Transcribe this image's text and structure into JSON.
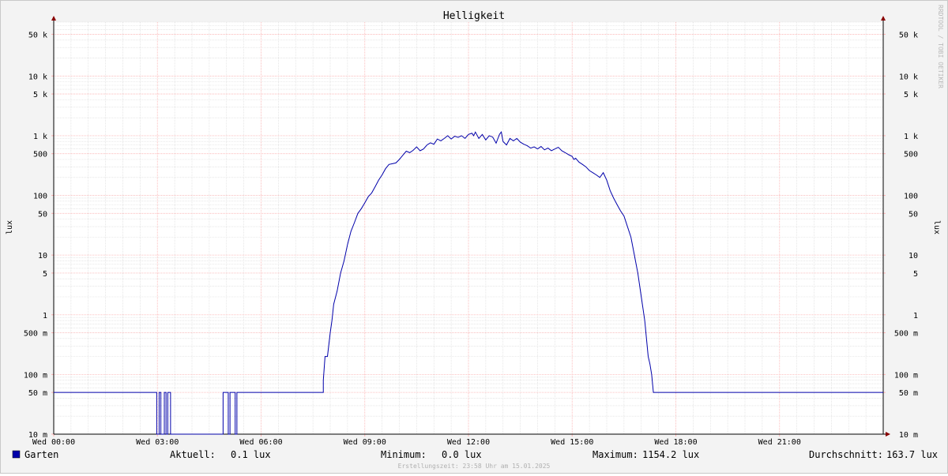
{
  "chart_data": {
    "type": "line",
    "title": "Helligkeit",
    "ylabel": "lux",
    "y_scale": "log",
    "ylim": [
      0.01,
      80000
    ],
    "x_range_hours": [
      0,
      24
    ],
    "x_ticks": [
      {
        "h": 0,
        "label": "Wed 00:00"
      },
      {
        "h": 3,
        "label": "Wed 03:00"
      },
      {
        "h": 6,
        "label": "Wed 06:00"
      },
      {
        "h": 9,
        "label": "Wed 09:00"
      },
      {
        "h": 12,
        "label": "Wed 12:00"
      },
      {
        "h": 15,
        "label": "Wed 15:00"
      },
      {
        "h": 18,
        "label": "Wed 18:00"
      },
      {
        "h": 21,
        "label": "Wed 21:00"
      }
    ],
    "y_ticks": [
      {
        "v": 0.01,
        "label": "10 m"
      },
      {
        "v": 0.05,
        "label": "50 m"
      },
      {
        "v": 0.1,
        "label": "100 m"
      },
      {
        "v": 0.5,
        "label": "500 m"
      },
      {
        "v": 1,
        "label": "1"
      },
      {
        "v": 5,
        "label": "5"
      },
      {
        "v": 10,
        "label": "10"
      },
      {
        "v": 50,
        "label": "50"
      },
      {
        "v": 100,
        "label": "100"
      },
      {
        "v": 500,
        "label": "500"
      },
      {
        "v": 1000,
        "label": "1 k"
      },
      {
        "v": 5000,
        "label": "5 k"
      },
      {
        "v": 10000,
        "label": "10 k"
      },
      {
        "v": 50000,
        "label": "50 k"
      }
    ],
    "series": [
      {
        "name": "Garten",
        "color": "#0000aa",
        "points": [
          [
            0,
            0.05
          ],
          [
            2.98,
            0.05
          ],
          [
            2.98,
            0.01
          ],
          [
            3.05,
            0.01
          ],
          [
            3.05,
            0.05
          ],
          [
            3.1,
            0.05
          ],
          [
            3.1,
            0.01
          ],
          [
            3.2,
            0.01
          ],
          [
            3.2,
            0.05
          ],
          [
            3.25,
            0.05
          ],
          [
            3.25,
            0.01
          ],
          [
            3.3,
            0.01
          ],
          [
            3.3,
            0.05
          ],
          [
            3.38,
            0.05
          ],
          [
            3.38,
            0.01
          ],
          [
            4.9,
            0.01
          ],
          [
            4.9,
            0.05
          ],
          [
            5.05,
            0.05
          ],
          [
            5.05,
            0.01
          ],
          [
            5.1,
            0.01
          ],
          [
            5.1,
            0.05
          ],
          [
            5.25,
            0.05
          ],
          [
            5.25,
            0.01
          ],
          [
            5.3,
            0.01
          ],
          [
            5.3,
            0.05
          ],
          [
            7.8,
            0.05
          ],
          [
            7.8,
            0.08
          ],
          [
            7.85,
            0.2
          ],
          [
            7.92,
            0.2
          ],
          [
            8.0,
            0.5
          ],
          [
            8.05,
            0.8
          ],
          [
            8.1,
            1.5
          ],
          [
            8.2,
            2.5
          ],
          [
            8.3,
            5
          ],
          [
            8.4,
            8
          ],
          [
            8.5,
            15
          ],
          [
            8.6,
            25
          ],
          [
            8.7,
            35
          ],
          [
            8.8,
            50
          ],
          [
            8.9,
            60
          ],
          [
            9.0,
            75
          ],
          [
            9.1,
            95
          ],
          [
            9.2,
            110
          ],
          [
            9.3,
            140
          ],
          [
            9.4,
            180
          ],
          [
            9.5,
            220
          ],
          [
            9.6,
            280
          ],
          [
            9.7,
            330
          ],
          [
            9.8,
            340
          ],
          [
            9.9,
            350
          ],
          [
            10.0,
            400
          ],
          [
            10.1,
            470
          ],
          [
            10.2,
            550
          ],
          [
            10.3,
            520
          ],
          [
            10.4,
            570
          ],
          [
            10.5,
            650
          ],
          [
            10.6,
            560
          ],
          [
            10.7,
            600
          ],
          [
            10.8,
            700
          ],
          [
            10.9,
            760
          ],
          [
            11.0,
            720
          ],
          [
            11.1,
            880
          ],
          [
            11.2,
            820
          ],
          [
            11.3,
            900
          ],
          [
            11.4,
            1000
          ],
          [
            11.5,
            880
          ],
          [
            11.6,
            980
          ],
          [
            11.7,
            940
          ],
          [
            11.8,
            1000
          ],
          [
            11.9,
            900
          ],
          [
            12.0,
            1050
          ],
          [
            12.1,
            1100
          ],
          [
            12.15,
            1000
          ],
          [
            12.2,
            1150
          ],
          [
            12.3,
            900
          ],
          [
            12.4,
            1050
          ],
          [
            12.5,
            850
          ],
          [
            12.6,
            1000
          ],
          [
            12.7,
            950
          ],
          [
            12.8,
            750
          ],
          [
            12.9,
            1060
          ],
          [
            12.95,
            1154.2
          ],
          [
            13.0,
            800
          ],
          [
            13.1,
            700
          ],
          [
            13.2,
            900
          ],
          [
            13.3,
            820
          ],
          [
            13.4,
            900
          ],
          [
            13.5,
            780
          ],
          [
            13.6,
            720
          ],
          [
            13.7,
            680
          ],
          [
            13.8,
            620
          ],
          [
            13.9,
            650
          ],
          [
            14.0,
            600
          ],
          [
            14.1,
            660
          ],
          [
            14.2,
            580
          ],
          [
            14.3,
            620
          ],
          [
            14.4,
            560
          ],
          [
            14.5,
            600
          ],
          [
            14.6,
            640
          ],
          [
            14.7,
            560
          ],
          [
            14.8,
            520
          ],
          [
            14.9,
            480
          ],
          [
            15.0,
            450
          ],
          [
            15.05,
            400
          ],
          [
            15.1,
            420
          ],
          [
            15.2,
            360
          ],
          [
            15.3,
            330
          ],
          [
            15.4,
            300
          ],
          [
            15.5,
            260
          ],
          [
            15.6,
            240
          ],
          [
            15.7,
            220
          ],
          [
            15.8,
            200
          ],
          [
            15.9,
            240
          ],
          [
            16.0,
            180
          ],
          [
            16.1,
            120
          ],
          [
            16.2,
            90
          ],
          [
            16.3,
            70
          ],
          [
            16.4,
            55
          ],
          [
            16.5,
            45
          ],
          [
            16.6,
            30
          ],
          [
            16.7,
            20
          ],
          [
            16.8,
            10
          ],
          [
            16.9,
            5
          ],
          [
            17.0,
            2
          ],
          [
            17.1,
            0.8
          ],
          [
            17.15,
            0.4
          ],
          [
            17.2,
            0.2
          ],
          [
            17.25,
            0.15
          ],
          [
            17.3,
            0.1
          ],
          [
            17.35,
            0.05
          ],
          [
            24,
            0.05
          ]
        ]
      }
    ]
  },
  "legend": {
    "series_name": "Garten",
    "current_label": "Aktuell:",
    "current_value": "0.1 lux",
    "min_label": "Minimum:",
    "min_value": "0.0 lux",
    "max_label": "Maximum:",
    "max_value": "1154.2 lux",
    "avg_label": "Durchschnitt:",
    "avg_value": "163.7 lux"
  },
  "footer": "Erstellungszeit: 23:58 Uhr am 15.01.2025",
  "watermark": "RRDTOOL / TOBI OETIKER",
  "colors": {
    "series": "#0000aa",
    "major_grid": "#ffb3b3",
    "minor_grid": "#d8d8d8",
    "axis": "#000000",
    "arrow": "#880000",
    "plot_bg": "#ffffff",
    "canvas_bg": "#f3f3f3"
  }
}
